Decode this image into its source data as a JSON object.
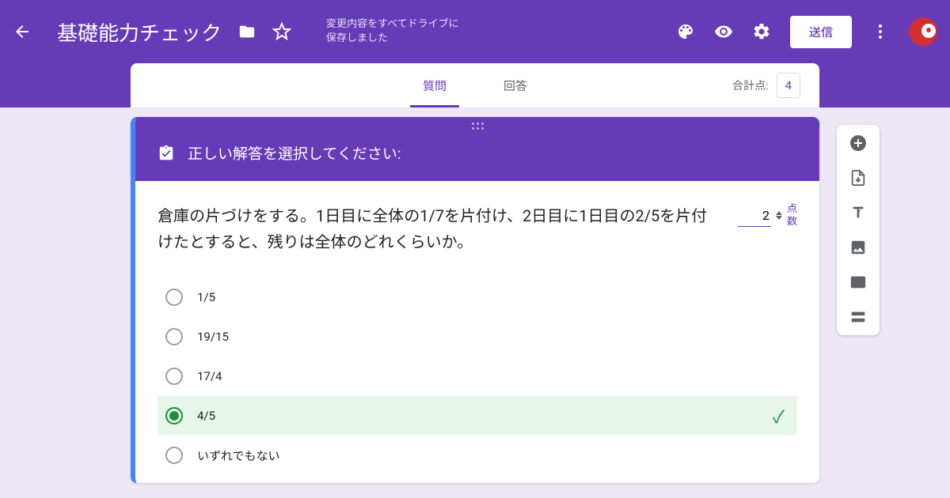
{
  "header": {
    "title": "基礎能力チェック",
    "save_status_line1": "変更内容をすべてドライブに",
    "save_status_line2": "保存しました",
    "send_label": "送信"
  },
  "tabs": {
    "questions": "質問",
    "responses": "回答",
    "total_label": "合計点:",
    "total_value": "4"
  },
  "question": {
    "instruction": "正しい解答を選択してください:",
    "text": "倉庫の片づけをする。1日目に全体の1/7を片付け、2日目に1日目の2/5を片付けたとすると、残りは全体のどれくらいか。",
    "points_value": "2",
    "points_label_1": "点",
    "points_label_2": "数",
    "options": [
      "1/5",
      "19/15",
      "17/4",
      "4/5",
      "いずれでもない"
    ]
  }
}
